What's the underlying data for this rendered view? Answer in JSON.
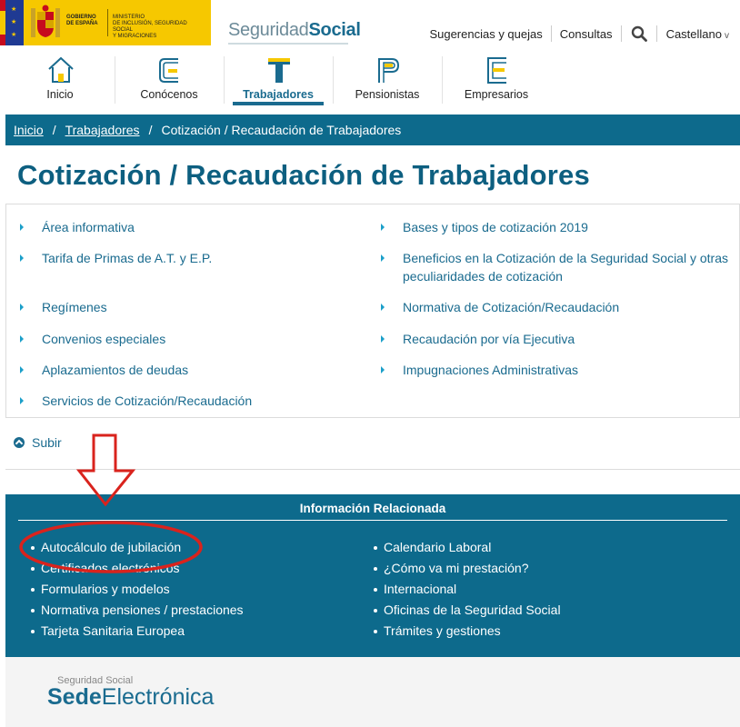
{
  "header": {
    "gov_lines": [
      "GOBIERNO",
      "DE ESPAÑA"
    ],
    "ministry_lines": [
      "MINISTERIO",
      "DE INCLUSIÓN, SEGURIDAD SOCIAL",
      "Y MIGRACIONES"
    ],
    "brand_light": "Seguridad",
    "brand_bold": "Social",
    "top_links": {
      "suggestions": "Sugerencias y quejas",
      "consultas": "Consultas",
      "language": "Castellano",
      "language_chevron": "v"
    },
    "search_icon": "search-icon"
  },
  "main_nav": [
    {
      "label": "Inicio",
      "icon": "home-icon"
    },
    {
      "label": "Conócenos",
      "icon": "letter-c-icon"
    },
    {
      "label": "Trabajadores",
      "icon": "letter-t-icon",
      "active": true
    },
    {
      "label": "Pensionistas",
      "icon": "letter-p-icon"
    },
    {
      "label": "Empresarios",
      "icon": "letter-e-icon"
    }
  ],
  "breadcrumb": {
    "items": [
      "Inicio",
      "Trabajadores"
    ],
    "current": "Cotización / Recaudación de Trabajadores",
    "separator": "/"
  },
  "page_title": "Cotización / Recaudación de Trabajadores",
  "links": {
    "left": [
      "Área informativa",
      "Tarifa de Primas de A.T. y E.P.",
      "Regímenes",
      "Convenios especiales",
      "Aplazamientos de deudas",
      "Servicios de Cotización/Recaudación"
    ],
    "right": [
      "Bases y tipos de cotización 2019",
      "Beneficios en la Cotización de la Seguridad Social y otras",
      "peculiaridades de cotización",
      "Normativa de Cotización/Recaudación",
      "Recaudación por vía Ejecutiva",
      "Impugnaciones Administrativas"
    ]
  },
  "subir": "Subir",
  "related": {
    "title": "Información Relacionada",
    "left": [
      "Autocálculo de jubilación",
      "Certificados electrónicos",
      "Formularios y modelos",
      "Normativa pensiones / prestaciones",
      "Tarjeta Sanitaria Europea"
    ],
    "right": [
      "Calendario Laboral",
      "¿Cómo va mi prestación?",
      "Internacional",
      "Oficinas de la Seguridad Social",
      "Trámites y gestiones"
    ]
  },
  "footer": {
    "small": "Seguridad Social",
    "big_bold": "Sede",
    "big_light": "Electrónica"
  },
  "colors": {
    "brand": "#0d6a8c",
    "title": "#0d5f80",
    "gov_yellow": "#f6c800",
    "annotation_red": "#d9231d"
  }
}
